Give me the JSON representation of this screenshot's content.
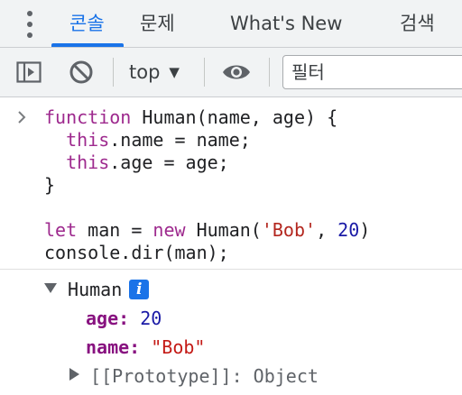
{
  "tabs": [
    {
      "label": "콘솔",
      "active": true
    },
    {
      "label": "문제",
      "active": false
    },
    {
      "label": "What's New",
      "active": false
    },
    {
      "label": "검색",
      "active": false
    }
  ],
  "toolbar": {
    "context_label": "top",
    "filter_placeholder": "필터",
    "icons": [
      "sidebar-toggle-icon",
      "clear-console-icon",
      "live-expression-eye-icon"
    ]
  },
  "console_input": {
    "lines": [
      [
        {
          "t": "function",
          "c": "kw"
        },
        {
          "t": " Human(name, age) {",
          "c": "fn"
        }
      ],
      [
        {
          "t": "  ",
          "c": "fn"
        },
        {
          "t": "this",
          "c": "kw"
        },
        {
          "t": ".name = name;",
          "c": "fn"
        }
      ],
      [
        {
          "t": "  ",
          "c": "fn"
        },
        {
          "t": "this",
          "c": "kw"
        },
        {
          "t": ".age = age;",
          "c": "fn"
        }
      ],
      [
        {
          "t": "}",
          "c": "fn"
        }
      ],
      [
        {
          "t": "",
          "c": "fn"
        }
      ],
      [
        {
          "t": "let",
          "c": "kw"
        },
        {
          "t": " man = ",
          "c": "fn"
        },
        {
          "t": "new",
          "c": "kw"
        },
        {
          "t": " Human(",
          "c": "fn"
        },
        {
          "t": "'Bob'",
          "c": "str"
        },
        {
          "t": ", ",
          "c": "fn"
        },
        {
          "t": "20",
          "c": "num"
        },
        {
          "t": ")",
          "c": "fn"
        }
      ],
      [
        {
          "t": "console.dir(man);",
          "c": "fn"
        }
      ]
    ]
  },
  "console_output": {
    "object_name": "Human",
    "info_badge": "i",
    "properties": [
      {
        "key": "age",
        "colon": ":",
        "value": "20",
        "type": "num"
      },
      {
        "key": "name",
        "colon": ":",
        "value": "\"Bob\"",
        "type": "str"
      }
    ],
    "prototype_label": "[[Prototype]]: Object"
  },
  "colors": {
    "accent": "#1a73e8",
    "keyword": "#9e2a8e",
    "string": "#c41a16",
    "number": "#1a1aa6",
    "property_key": "#881280"
  }
}
